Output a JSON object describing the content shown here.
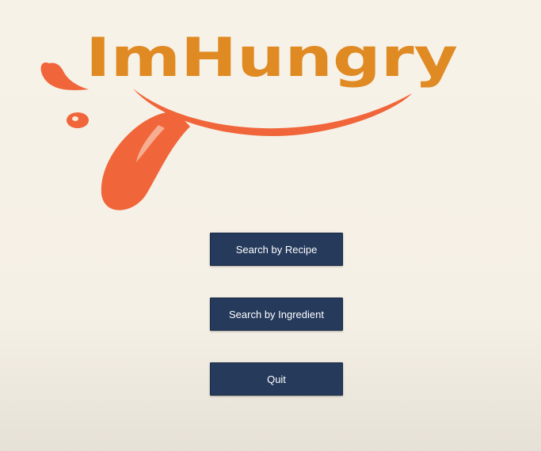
{
  "logo": {
    "text": "ImHungry",
    "text_color": "#e08a24",
    "tongue_color": "#f0663a"
  },
  "menu": {
    "search_recipe_label": "Search by Recipe",
    "search_ingredient_label": "Search by Ingredient",
    "quit_label": "Quit"
  },
  "colors": {
    "background": "#f7f2e8",
    "button_bg": "#263a5c",
    "button_text": "#ffffff"
  }
}
